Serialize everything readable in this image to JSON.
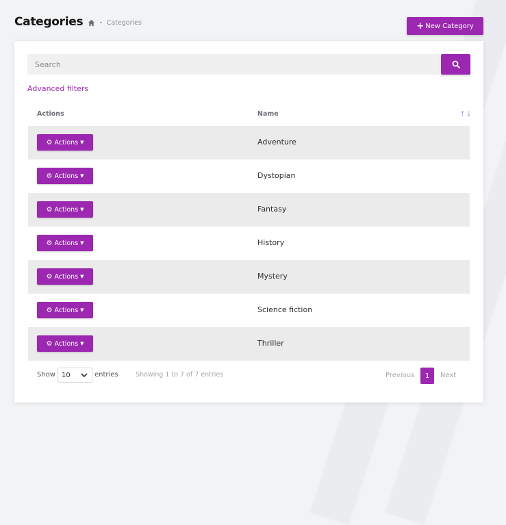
{
  "header": {
    "title": "Categories",
    "breadcrumb": {
      "home_icon": "home-icon",
      "separator": "•",
      "current": "Categories"
    },
    "new_button": {
      "icon": "plus-icon",
      "label": "New Category"
    }
  },
  "search": {
    "placeholder": "Search",
    "value": "",
    "button_icon": "search-icon"
  },
  "advanced_filters_label": "Advanced filters",
  "table": {
    "columns": [
      "Actions",
      "Name"
    ],
    "sort_icon": "sort-icon",
    "action_button": {
      "icon": "gear-icon",
      "label": "Actions",
      "caret_icon": "caret-down-icon"
    },
    "rows": [
      {
        "name": "Adventure"
      },
      {
        "name": "Dystopian"
      },
      {
        "name": "Fantasy"
      },
      {
        "name": "History"
      },
      {
        "name": "Mystery"
      },
      {
        "name": "Science fiction"
      },
      {
        "name": "Thriller"
      }
    ]
  },
  "footer": {
    "show_label": "Show",
    "page_size": "10",
    "entries_label": "entries",
    "info": "Showing 1 to 7 of 7 entries",
    "previous_label": "Previous",
    "current_page": "1",
    "next_label": "Next"
  },
  "colors": {
    "accent": "#9c27b0",
    "row_stripe": "#ebebeb",
    "background": "#f2f3f5"
  }
}
